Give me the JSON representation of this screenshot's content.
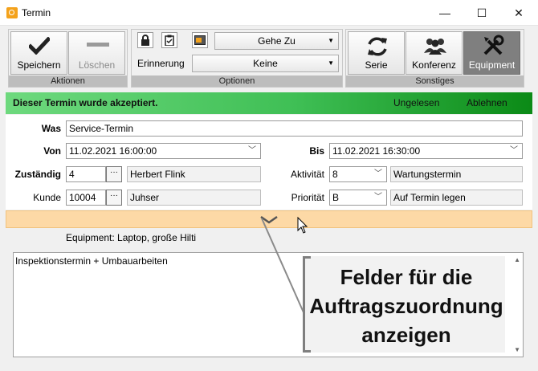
{
  "window": {
    "title": "Termin",
    "minimize": "—",
    "maximize": "☐",
    "close": "✕"
  },
  "ribbon": {
    "aktionen": {
      "label": "Aktionen",
      "save": "Speichern",
      "delete": "Löschen"
    },
    "optionen": {
      "label": "Optionen",
      "reminder_label": "Erinnerung",
      "goto_value": "Gehe Zu",
      "reminder_value": "Keine"
    },
    "sonstiges": {
      "label": "Sonstiges",
      "serie": "Serie",
      "konferenz": "Konferenz",
      "equipment": "Equipment"
    }
  },
  "banner": {
    "message": "Dieser Termin wurde akzeptiert.",
    "unread": "Ungelesen",
    "decline": "Ablehnen"
  },
  "form": {
    "was_label": "Was",
    "was_value": "Service-Termin",
    "von_label": "Von",
    "von_value": "11.02.2021 16:00:00",
    "bis_label": "Bis",
    "bis_value": "11.02.2021 16:30:00",
    "zustaendig_label": "Zuständig",
    "zustaendig_id": "4",
    "zustaendig_name": "Herbert Flink",
    "aktivitaet_label": "Aktivität",
    "aktivitaet_id": "8",
    "aktivitaet_name": "Wartungstermin",
    "kunde_label": "Kunde",
    "kunde_id": "10004",
    "kunde_name": "Juhser",
    "prioritaet_label": "Priorität",
    "prioritaet_id": "B",
    "prioritaet_name": "Auf Termin legen",
    "dots": "···"
  },
  "equipment_text": "Equipment: Laptop, große Hilti",
  "notes_text": "Inspektionstermin + Umbauarbeiten",
  "callout_lines": [
    "Felder für die",
    "Auftragszuordnung",
    "anzeigen"
  ],
  "colors": {
    "banner_start": "#6ed97e",
    "banner_end": "#0b8a16",
    "expander": "#fdd9a6",
    "app_icon": "#f4a21b"
  }
}
